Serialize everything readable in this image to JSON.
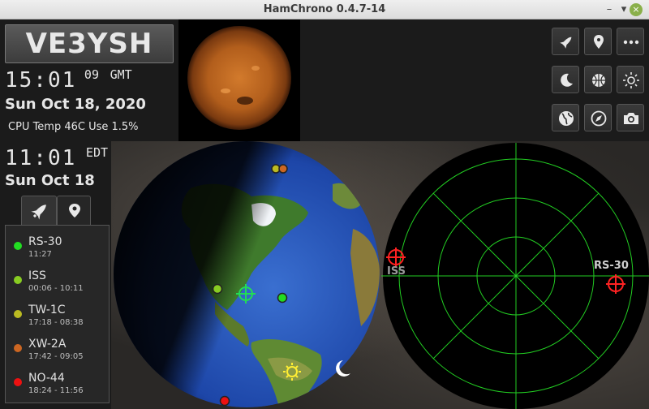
{
  "window": {
    "title": "HamChrono 0.4.7-14",
    "min": "–",
    "max": "▾",
    "close": "×"
  },
  "callsign": "VE3YSH",
  "gmt": {
    "hm": "15:01",
    "sec": "09",
    "tz": "GMT",
    "date": "Sun Oct 18, 2020"
  },
  "cpu": {
    "text": "CPU Temp 46C Use  1.5%"
  },
  "local": {
    "hm": "11:01",
    "tz": "EDT",
    "date": "Sun Oct 18"
  },
  "tabs": [
    {
      "icon": "rocket-icon",
      "active": true
    },
    {
      "icon": "location-pin-icon",
      "active": false
    }
  ],
  "satellites": [
    {
      "name": "RS-30",
      "time": "11:27",
      "color": "#22dd22"
    },
    {
      "name": "ISS",
      "time": "00:06 - 10:11",
      "color": "#88cc22"
    },
    {
      "name": "TW-1C",
      "time": "17:18 - 08:38",
      "color": "#bbbb22"
    },
    {
      "name": "XW-2A",
      "time": "17:42 - 09:05",
      "color": "#cc6622"
    },
    {
      "name": "NO-44",
      "time": "18:24 - 11:56",
      "color": "#ee1111"
    }
  ],
  "toolbar": [
    {
      "icon": "rocket-icon"
    },
    {
      "icon": "location-pin-icon"
    },
    {
      "icon": "more-dots-icon"
    },
    {
      "icon": "moon-icon"
    },
    {
      "icon": "basketball-icon"
    },
    {
      "icon": "sun-icon"
    },
    {
      "icon": "globe-icon"
    },
    {
      "icon": "compass-icon"
    },
    {
      "icon": "camera-icon"
    }
  ],
  "radar": {
    "labels": {
      "iss": "ISS",
      "rs30": "RS-30"
    }
  },
  "colors": {
    "radar_grid": "#22cc22",
    "target_red": "#ff2222",
    "target_green": "#22dd55"
  }
}
